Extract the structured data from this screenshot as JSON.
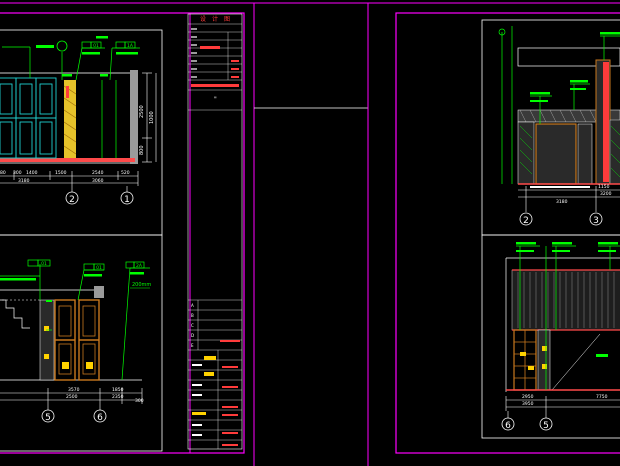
{
  "colors": {
    "background": "#000000",
    "sheet_border": "#ff00ff",
    "frame": "#ffffff",
    "dimension": "#ffffff",
    "annotation": "#00ff00",
    "callout_text": "#00ff00",
    "hatch_red": "#ff3b3b",
    "wood": "#c8781e",
    "gold": "#ffd200",
    "pattern_yellow": "#e6c22a",
    "cyan": "#1fd0d0",
    "dark_fill": "#2a2a2a",
    "floor_red": "#ff4a4a"
  },
  "left_sheet": {
    "elev_top": {
      "dims": [
        "80",
        "300",
        "1400",
        "1500",
        "2540",
        "520"
      ],
      "totals": [
        "3180",
        "3060"
      ],
      "heights": [
        "2500",
        "1000",
        "800"
      ],
      "grid_labels": [
        "2",
        "1"
      ],
      "tags": [
        "01",
        "1A"
      ]
    },
    "elev_bottom": {
      "dims": [
        "3570",
        "1850"
      ],
      "totals": [
        "2500",
        "2350",
        "300"
      ],
      "grid_labels": [
        "5",
        "6"
      ],
      "tags": [
        "01",
        "01",
        "2A"
      ],
      "callout": "200mm"
    },
    "title_block": {
      "header": [
        "设",
        "计",
        "图"
      ],
      "stamp": "\"",
      "row_letters": [
        "A",
        "B",
        "C",
        "D",
        "E",
        "F"
      ]
    }
  },
  "right_sheet": {
    "elev_top": {
      "grid_labels": [
        "2",
        "3"
      ],
      "dims": [
        "1150",
        "3200",
        "3180"
      ]
    },
    "elev_bottom": {
      "grid_labels": [
        "6",
        "5"
      ],
      "dims": [
        "2950",
        "3950",
        "7750"
      ]
    }
  }
}
